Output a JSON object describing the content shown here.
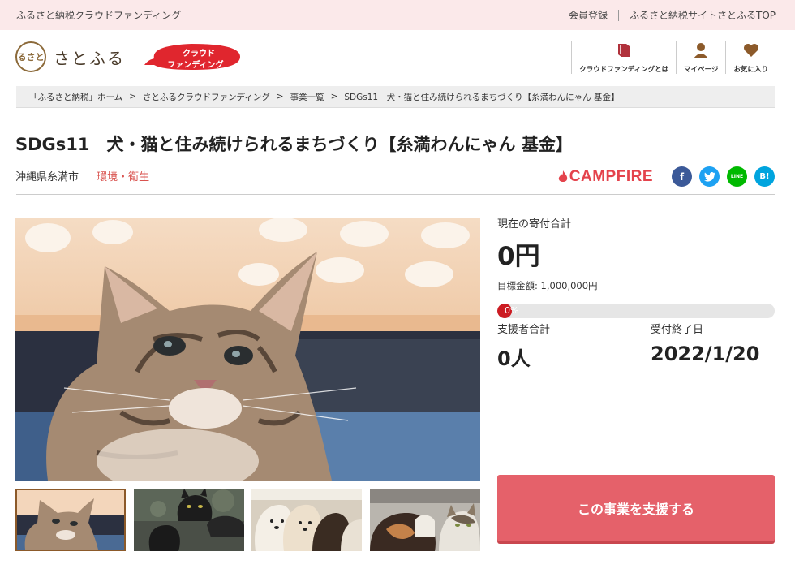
{
  "topbar": {
    "site_label": "ふるさと納税クラウドファンディング",
    "member_register": "会員登録",
    "top_link": "ふるさと納税サイトさとふるTOP"
  },
  "header": {
    "logo_mark": "るさと",
    "logo_text": "さとふる",
    "badge_line1": "クラウド",
    "badge_line2": "ファンディング",
    "badge_color": "#e0262e",
    "nav": [
      {
        "label": "クラウドファンディングとは",
        "icon": "book-icon"
      },
      {
        "label": "マイページ",
        "icon": "user-icon"
      },
      {
        "label": "お気に入り",
        "icon": "heart-icon"
      }
    ],
    "nav_icon_color": "#b0313b"
  },
  "breadcrumb": [
    "「ふるさと納税」ホーム",
    "さとふるクラウドファンディング",
    "事業一覧",
    "SDGs11　犬・猫と住み続けられるまちづくり【糸満わんにゃん 基金】"
  ],
  "project": {
    "title": "SDGs11　犬・猫と住み続けられるまちづくり【糸満わんにゃん 基金】",
    "location": "沖縄県糸満市",
    "category": "環境・衛生",
    "platform": "CAMPFIRE"
  },
  "share": [
    {
      "name": "facebook",
      "glyph": "f",
      "color": "#3b5998"
    },
    {
      "name": "twitter",
      "glyph": "t",
      "color": "#1da1f2"
    },
    {
      "name": "line",
      "glyph": "LINE",
      "color": "#00b900"
    },
    {
      "name": "hatena",
      "glyph": "B!",
      "color": "#00a4de"
    }
  ],
  "stats": {
    "total_label": "現在の寄付合計",
    "total_value": "0円",
    "goal_label": "目標金額: 1,000,000円",
    "progress_percent": 0,
    "progress_label": "0%",
    "supporters_label": "支援者合計",
    "supporters_value": "0人",
    "deadline_label": "受付終了日",
    "deadline_value": "2022/1/20"
  },
  "support_button": "この事業を支援する",
  "accent_color": "#e5616a"
}
